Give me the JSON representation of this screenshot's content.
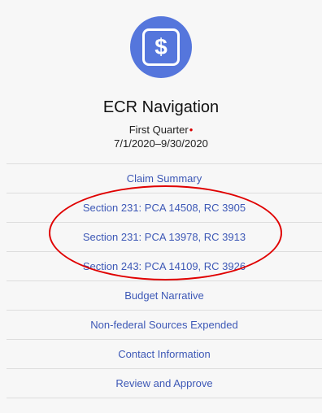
{
  "header": {
    "logo_icon": "dollar-icon",
    "title": "ECR Navigation",
    "quarter_label": "First Quarter",
    "required_marker": "•",
    "date_range": "7/1/2020–9/30/2020"
  },
  "colors": {
    "accent": "#5576dc",
    "link": "#3d58b6",
    "annotation": "#e00000"
  },
  "nav": {
    "items": [
      {
        "label": "Claim Summary"
      },
      {
        "label": "Section 231: PCA 14508, RC 3905"
      },
      {
        "label": "Section 231: PCA 13978, RC 3913"
      },
      {
        "label": "Section 243: PCA 14109, RC 3926"
      },
      {
        "label": "Budget Narrative"
      },
      {
        "label": "Non-federal Sources Expended"
      },
      {
        "label": "Contact Information"
      },
      {
        "label": "Review and Approve"
      }
    ]
  }
}
